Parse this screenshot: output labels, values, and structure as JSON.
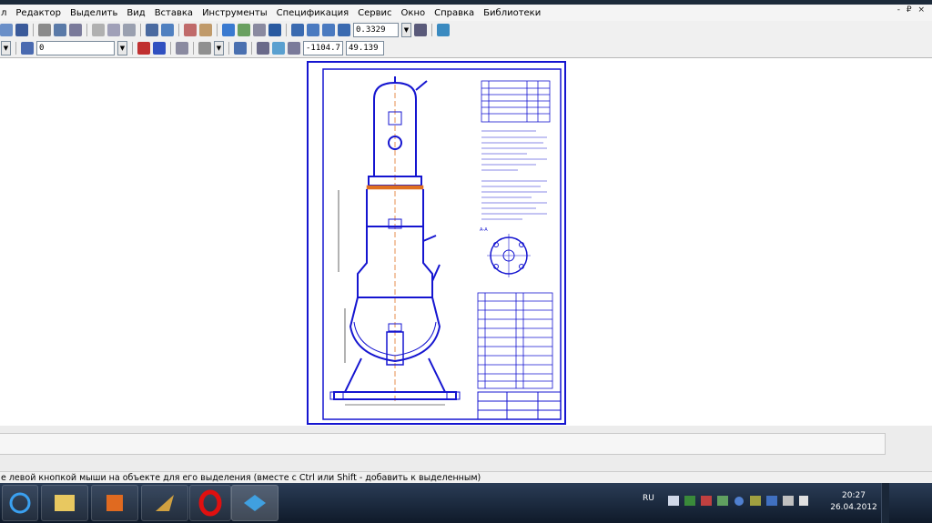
{
  "menu": {
    "items": [
      "л",
      "Редактор",
      "Выделить",
      "Вид",
      "Вставка",
      "Инструменты",
      "Спецификация",
      "Сервис",
      "Окно",
      "Справка",
      "Библиотеки"
    ],
    "window_controls": "- ₽ ×"
  },
  "toolbar1": {
    "zoom_value": "0.3329"
  },
  "toolbar2": {
    "layer_value": "0",
    "coord_x": "-1104.7",
    "coord_y": "49.139"
  },
  "status": {
    "text": "е левой кнопкой мыши на объекте для его выделения (вместе с Ctrl или Shift - добавить к выделенным)"
  },
  "taskbar": {
    "language": "RU",
    "time": "20:27",
    "date": "26.04.2012"
  },
  "drawing": {
    "section_label": "А-А"
  },
  "colors": {
    "drawing_line": "#1515d0",
    "axis_line": "#e07020",
    "taskbar": "#1a2738"
  }
}
